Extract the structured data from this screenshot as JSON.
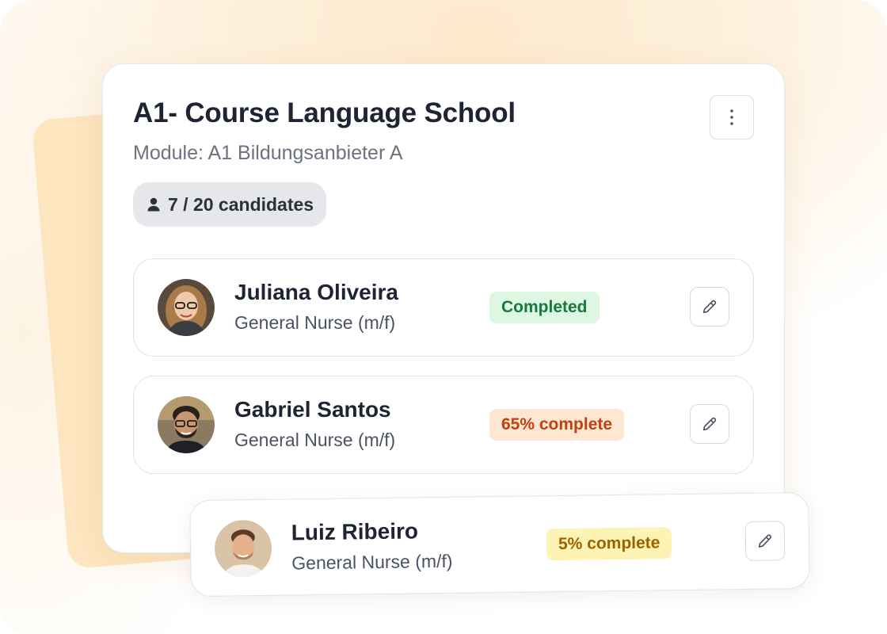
{
  "course": {
    "title": "A1- Course Language School",
    "module": "Module: A1 Bildungsanbieter A",
    "candidates_badge": "7 / 20 candidates",
    "menu_icon": "more-vertical-icon"
  },
  "candidates": [
    {
      "name": "Juliana Oliveira",
      "role": "General Nurse (m/f)",
      "status": "Completed",
      "status_color": "#157a3a",
      "status_bg": "#ddf7e3",
      "edit_icon": "pencil-icon"
    },
    {
      "name": "Gabriel Santos",
      "role": "General Nurse (m/f)",
      "status": "65% complete",
      "progress_percent": 65,
      "status_color": "#c2410c",
      "status_bg": "#fde7d3",
      "edit_icon": "pencil-icon"
    },
    {
      "name": "Luiz Ribeiro",
      "role": "General Nurse (m/f)",
      "status": "5% complete",
      "progress_percent": 5,
      "status_color": "#9a6200",
      "status_bg": "#fdf3b4",
      "edit_icon": "pencil-icon"
    }
  ],
  "colors": {
    "accent_back_card": "#fde2b8",
    "title_text": "#1f2433",
    "muted_text": "#6b7280"
  }
}
